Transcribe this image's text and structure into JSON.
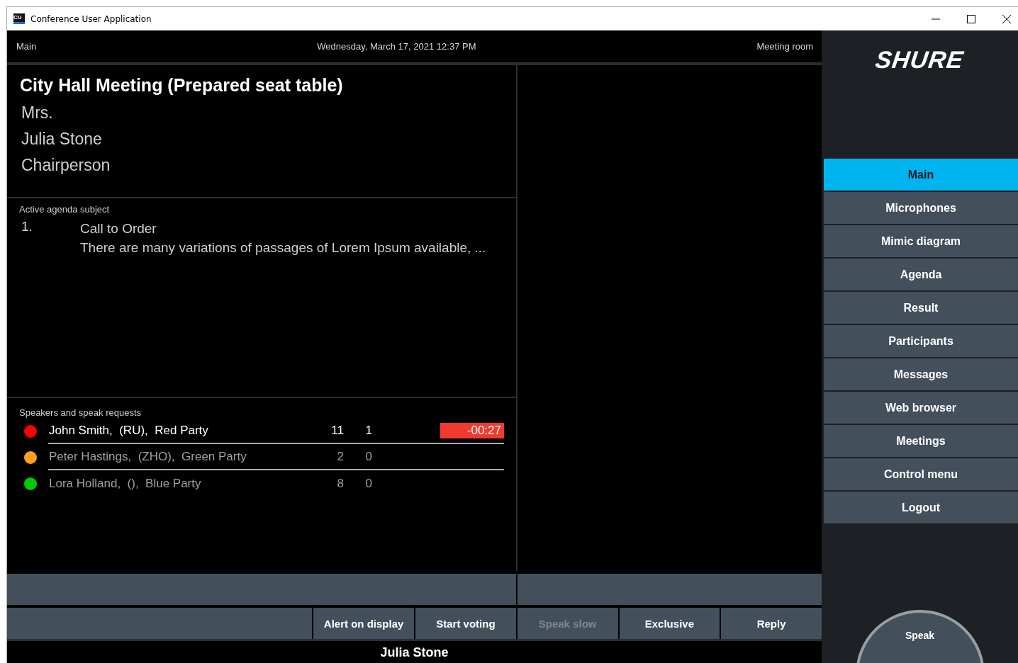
{
  "window": {
    "title": "Conference User Application",
    "app_icon": "CU"
  },
  "header": {
    "location": "Main",
    "datetime": "Wednesday, March 17, 2021 12:37 PM",
    "room": "Meeting room"
  },
  "meeting": {
    "title": "City Hall Meeting (Prepared seat table)",
    "lines": [
      "Mrs.",
      "Julia Stone",
      "Chairperson"
    ]
  },
  "agenda": {
    "heading": "Active agenda subject",
    "number": "1.",
    "subject": "Call to Order",
    "description": "There are many variations of passages of Lorem Ipsum available, ..."
  },
  "speakers": {
    "heading": "Speakers and speak requests",
    "rows": [
      {
        "name": "John Smith,  (RU),  Red Party",
        "color": "#ff0000",
        "count": "11",
        "column_3": "1",
        "timer": "-00:27",
        "selected": true
      },
      {
        "name": "Peter Hastings,  (ZHO),  Green Party",
        "color": "#ffa020",
        "count": "2",
        "column_3": "0",
        "selected": false
      },
      {
        "name": "Lora Holland,  (),  Blue Party",
        "color": "#00cc00",
        "count": "8",
        "column_3": "0",
        "selected": false
      }
    ]
  },
  "action_buttons": [
    {
      "label": "Alert on display",
      "disabled": false
    },
    {
      "label": "Start voting",
      "disabled": false
    },
    {
      "label": "Speak slow",
      "disabled": true
    },
    {
      "label": "Exclusive",
      "disabled": false
    },
    {
      "label": "Reply",
      "disabled": false
    }
  ],
  "footer": {
    "name": "Julia Stone"
  },
  "sidebar": {
    "logo": "SHURE",
    "items": [
      {
        "label": "Main",
        "selected": true
      },
      {
        "label": "Microphones",
        "selected": false
      },
      {
        "label": "Mimic diagram",
        "selected": false
      },
      {
        "label": "Agenda",
        "selected": false
      },
      {
        "label": "Result",
        "selected": false
      },
      {
        "label": "Participants",
        "selected": false
      },
      {
        "label": "Messages",
        "selected": false
      },
      {
        "label": "Web browser",
        "selected": false
      },
      {
        "label": "Meetings",
        "selected": false
      },
      {
        "label": "Control menu",
        "selected": false
      },
      {
        "label": "Logout",
        "selected": false
      }
    ],
    "speak_button": "Speak"
  }
}
